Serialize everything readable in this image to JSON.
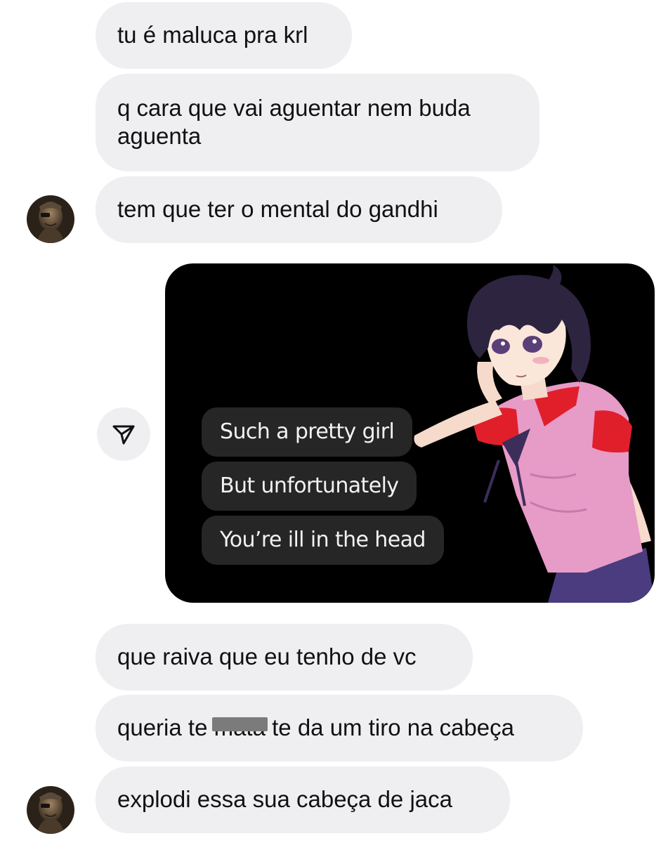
{
  "messages": [
    {
      "text": "tu é maluca pra krl"
    },
    {
      "text": "q cara que vai aguentar nem buda aguenta"
    },
    {
      "text": "tem que ter o mental do gandhi"
    },
    {
      "text": "que raiva que eu tenho de vc"
    },
    {
      "text_before": "queria te ",
      "censored": "mata",
      "text_after": " te da um tiro na cabeça"
    },
    {
      "text": "explodi essa sua cabeça de jaca"
    }
  ],
  "shared_image": {
    "lines": [
      "Such a pretty girl",
      "But unfortunately",
      "You’re ill in the head"
    ]
  },
  "colors": {
    "bubble_bg": "#efeff1",
    "meme_bg": "#000000",
    "meme_bubble": "#262626"
  },
  "icons": {
    "share": "paper-plane-icon"
  }
}
